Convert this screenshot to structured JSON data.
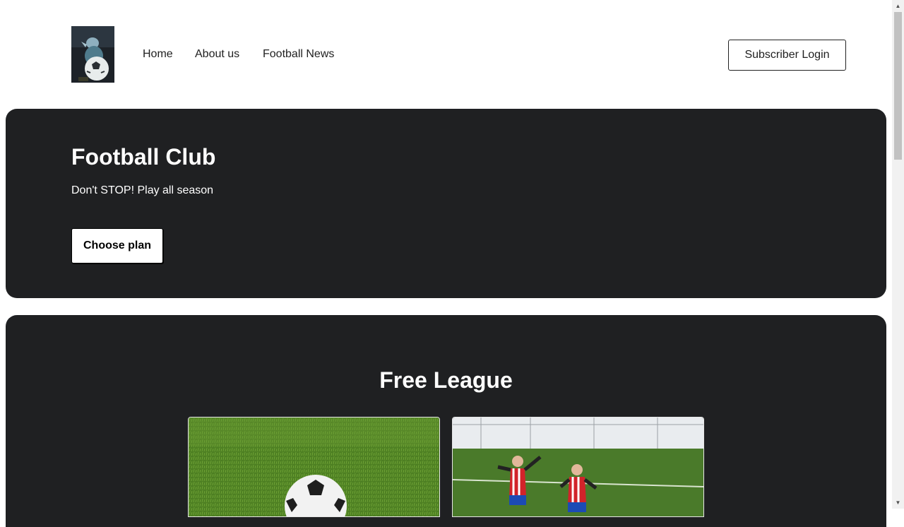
{
  "header": {
    "logo_alt": "Football Club logo",
    "nav": [
      {
        "label": "Home"
      },
      {
        "label": "About us"
      },
      {
        "label": "Football News"
      }
    ],
    "login_label": "Subscriber Login"
  },
  "hero": {
    "title": "Football Club",
    "subtitle": "Don't STOP! Play all season",
    "cta_label": "Choose plan"
  },
  "league": {
    "title": "Free League",
    "cards": [
      {
        "image": "soccer-ball-on-grass"
      },
      {
        "image": "kids-celebrating-on-pitch"
      }
    ]
  },
  "colors": {
    "dark_panel": "#1f2022",
    "text": "#212121",
    "white": "#ffffff",
    "pitch_green": "#4a7a2a"
  }
}
